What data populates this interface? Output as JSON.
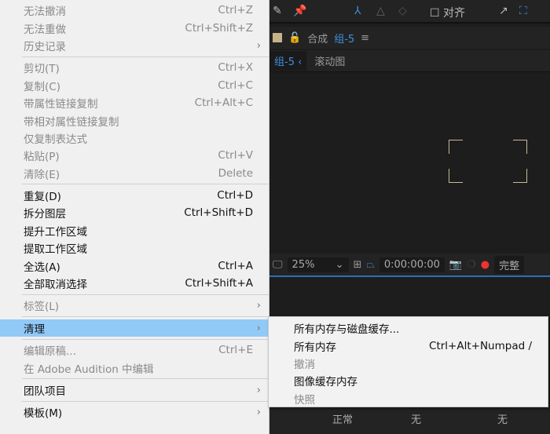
{
  "app": {
    "align_label": "对齐",
    "comp_label": "合成",
    "comp_name": "组-5",
    "tab_active": "组-5",
    "tab_other": "滚动图",
    "zoom": "25%",
    "timecode": "0:00:00:00",
    "quality": "完整",
    "blend_mode": "正常",
    "track_none1": "无",
    "track_none2": "无"
  },
  "menu": {
    "groups": [
      [
        {
          "label": "无法撤消",
          "shortcut": "Ctrl+Z",
          "disabled": true
        },
        {
          "label": "无法重做",
          "shortcut": "Ctrl+Shift+Z",
          "disabled": true
        },
        {
          "label": "历史记录",
          "shortcut": "",
          "disabled": true,
          "submenu": true
        }
      ],
      [
        {
          "label": "剪切(T)",
          "shortcut": "Ctrl+X",
          "disabled": true
        },
        {
          "label": "复制(C)",
          "shortcut": "Ctrl+C",
          "disabled": true
        },
        {
          "label": "带属性链接复制",
          "shortcut": "Ctrl+Alt+C",
          "disabled": true
        },
        {
          "label": "带相对属性链接复制",
          "shortcut": "",
          "disabled": true
        },
        {
          "label": "仅复制表达式",
          "shortcut": "",
          "disabled": true
        },
        {
          "label": "粘贴(P)",
          "shortcut": "Ctrl+V",
          "disabled": true
        },
        {
          "label": "清除(E)",
          "shortcut": "Delete",
          "disabled": true
        }
      ],
      [
        {
          "label": "重复(D)",
          "shortcut": "Ctrl+D"
        },
        {
          "label": "拆分图层",
          "shortcut": "Ctrl+Shift+D"
        },
        {
          "label": "提升工作区域",
          "shortcut": ""
        },
        {
          "label": "提取工作区域",
          "shortcut": ""
        },
        {
          "label": "全选(A)",
          "shortcut": "Ctrl+A"
        },
        {
          "label": "全部取消选择",
          "shortcut": "Ctrl+Shift+A"
        }
      ],
      [
        {
          "label": "标签(L)",
          "shortcut": "",
          "disabled": true,
          "submenu": true
        }
      ],
      [
        {
          "label": "清理",
          "shortcut": "",
          "submenu": true,
          "highlighted": true
        }
      ],
      [
        {
          "label": "编辑原稿...",
          "shortcut": "Ctrl+E",
          "disabled": true
        },
        {
          "label": "在 Adobe Audition 中编辑",
          "shortcut": "",
          "disabled": true
        }
      ],
      [
        {
          "label": "团队项目",
          "shortcut": "",
          "submenu": true
        }
      ],
      [
        {
          "label": "模板(M)",
          "shortcut": "",
          "submenu": true
        }
      ]
    ]
  },
  "submenu": {
    "items": [
      {
        "label": "所有内存与磁盘缓存...",
        "shortcut": ""
      },
      {
        "label": "所有内存",
        "shortcut": "Ctrl+Alt+Numpad /"
      },
      {
        "label": "撤消",
        "shortcut": "",
        "disabled": true
      },
      {
        "label": "图像缓存内存",
        "shortcut": ""
      },
      {
        "label": "快照",
        "shortcut": "",
        "disabled": true
      }
    ]
  }
}
